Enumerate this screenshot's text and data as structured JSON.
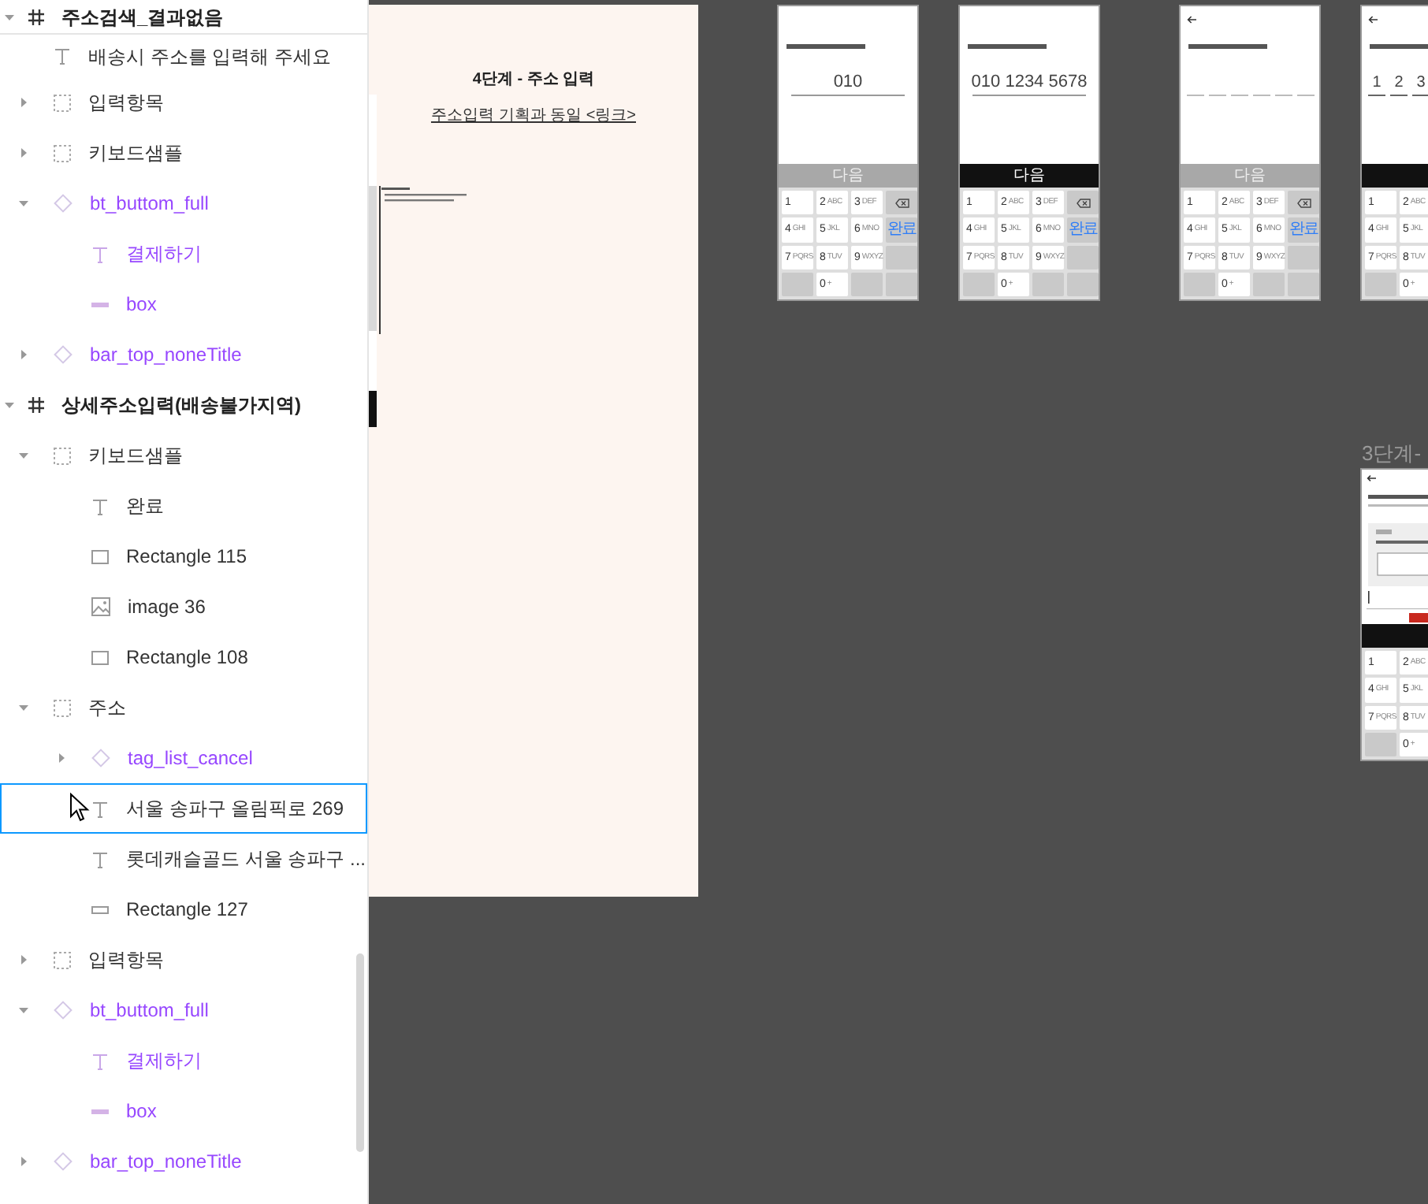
{
  "layers": [
    {
      "name": "주소검색_결과없음",
      "kind": "frame",
      "expanded": true,
      "selected": false,
      "children": [
        {
          "name": "배송시 주소를 입력해 주세요",
          "kind": "text",
          "selected": false
        },
        {
          "name": "입력항목",
          "kind": "group",
          "expanded": false,
          "selected": false
        },
        {
          "name": "키보드샘플",
          "kind": "group",
          "expanded": false,
          "selected": false
        },
        {
          "name": "bt_buttom_full",
          "kind": "component",
          "expanded": true,
          "selected": false,
          "children": [
            {
              "name": "결제하기",
              "kind": "text",
              "selected": false
            },
            {
              "name": "box",
              "kind": "line",
              "selected": false
            }
          ]
        },
        {
          "name": "bar_top_noneTitle",
          "kind": "component",
          "expanded": false,
          "selected": false
        }
      ]
    },
    {
      "name": "상세주소입력(배송불가지역)",
      "kind": "frame",
      "expanded": true,
      "selected": false,
      "children": [
        {
          "name": "키보드샘플",
          "kind": "group",
          "expanded": true,
          "selected": false,
          "children": [
            {
              "name": "완료",
              "kind": "text",
              "selected": false
            },
            {
              "name": "Rectangle 115",
              "kind": "rect",
              "selected": false
            },
            {
              "name": "image 36",
              "kind": "image",
              "selected": false
            },
            {
              "name": "Rectangle 108",
              "kind": "rect",
              "selected": false
            }
          ]
        },
        {
          "name": "주소",
          "kind": "group",
          "expanded": true,
          "selected": false,
          "children": [
            {
              "name": "tag_list_cancel",
              "kind": "component",
              "expanded": false,
              "selected": false
            },
            {
              "name": "서울 송파구 올림픽로 269",
              "kind": "text",
              "selected": true
            },
            {
              "name": "롯데캐슬골드 서울 송파구 ...",
              "kind": "text",
              "selected": false
            },
            {
              "name": "Rectangle 127",
              "kind": "flat_rect",
              "selected": false
            }
          ]
        },
        {
          "name": "입력항목",
          "kind": "group",
          "expanded": false,
          "selected": false
        },
        {
          "name": "bt_buttom_full",
          "kind": "component",
          "expanded": true,
          "selected": false,
          "children": [
            {
              "name": "결제하기",
              "kind": "text",
              "selected": false
            },
            {
              "name": "box",
              "kind": "line",
              "selected": false
            }
          ]
        },
        {
          "name": "bar_top_noneTitle",
          "kind": "component",
          "expanded": false,
          "selected": false
        }
      ]
    }
  ],
  "board": {
    "title": "4단계 - 주소 입력",
    "link": "주소입력 기획과 동일 <링크>"
  },
  "phones": [
    {
      "kind": "phone_number",
      "value": "010",
      "next_label": "다음",
      "next_enabled": false,
      "key_rows": [
        [
          {
            "kind": "digit",
            "label": "1"
          },
          {
            "kind": "digit",
            "label": "2",
            "sub": "ABC"
          },
          {
            "kind": "digit",
            "label": "3",
            "sub": "DEF"
          },
          {
            "kind": "delete"
          }
        ],
        [
          {
            "kind": "digit",
            "label": "4",
            "sub": "GHI"
          },
          {
            "kind": "digit",
            "label": "5",
            "sub": "JKL"
          },
          {
            "kind": "digit",
            "label": "6",
            "sub": "MNO"
          },
          {
            "kind": "done",
            "label": "완료"
          }
        ],
        [
          {
            "kind": "digit",
            "label": "7",
            "sub": "PQRS"
          },
          {
            "kind": "digit",
            "label": "8",
            "sub": "TUV"
          },
          {
            "kind": "digit",
            "label": "9",
            "sub": "WXYZ"
          },
          {
            "kind": "blank"
          }
        ],
        [
          {
            "kind": "blank"
          },
          {
            "kind": "digit",
            "label": "0",
            "sub": "+"
          },
          {
            "kind": "blank"
          },
          {
            "kind": "blank"
          }
        ]
      ]
    },
    {
      "kind": "phone_number",
      "value": "010 1234 5678",
      "next_label": "다음",
      "next_enabled": true,
      "key_rows": [
        [
          {
            "kind": "digit",
            "label": "1"
          },
          {
            "kind": "digit",
            "label": "2",
            "sub": "ABC"
          },
          {
            "kind": "digit",
            "label": "3",
            "sub": "DEF"
          },
          {
            "kind": "delete"
          }
        ],
        [
          {
            "kind": "digit",
            "label": "4",
            "sub": "GHI"
          },
          {
            "kind": "digit",
            "label": "5",
            "sub": "JKL"
          },
          {
            "kind": "digit",
            "label": "6",
            "sub": "MNO"
          },
          {
            "kind": "done",
            "label": "완료"
          }
        ],
        [
          {
            "kind": "digit",
            "label": "7",
            "sub": "PQRS"
          },
          {
            "kind": "digit",
            "label": "8",
            "sub": "TUV"
          },
          {
            "kind": "digit",
            "label": "9",
            "sub": "WXYZ"
          },
          {
            "kind": "blank"
          }
        ],
        [
          {
            "kind": "blank"
          },
          {
            "kind": "digit",
            "label": "0",
            "sub": "+"
          },
          {
            "kind": "blank"
          },
          {
            "kind": "blank"
          }
        ]
      ]
    },
    {
      "kind": "code",
      "cells": [
        {
          "filled": false
        },
        {
          "filled": false
        },
        {
          "filled": false
        },
        {
          "filled": false
        },
        {
          "filled": false
        },
        {
          "filled": false
        }
      ],
      "next_label": "다음",
      "next_enabled": false,
      "key_rows": [
        [
          {
            "kind": "digit",
            "label": "1"
          },
          {
            "kind": "digit",
            "label": "2",
            "sub": "ABC"
          },
          {
            "kind": "digit",
            "label": "3",
            "sub": "DEF"
          },
          {
            "kind": "delete"
          }
        ],
        [
          {
            "kind": "digit",
            "label": "4",
            "sub": "GHI"
          },
          {
            "kind": "digit",
            "label": "5",
            "sub": "JKL"
          },
          {
            "kind": "digit",
            "label": "6",
            "sub": "MNO"
          },
          {
            "kind": "done",
            "label": "완료"
          }
        ],
        [
          {
            "kind": "digit",
            "label": "7",
            "sub": "PQRS"
          },
          {
            "kind": "digit",
            "label": "8",
            "sub": "TUV"
          },
          {
            "kind": "digit",
            "label": "9",
            "sub": "WXYZ"
          },
          {
            "kind": "blank"
          }
        ],
        [
          {
            "kind": "blank"
          },
          {
            "kind": "digit",
            "label": "0",
            "sub": "+"
          },
          {
            "kind": "blank"
          },
          {
            "kind": "blank"
          }
        ]
      ]
    },
    {
      "kind": "code",
      "cells": [
        {
          "filled": true,
          "digit": "1"
        },
        {
          "filled": true,
          "digit": "2"
        },
        {
          "filled": true,
          "digit": "3"
        }
      ],
      "next_enabled": true,
      "key_rows": [
        [
          {
            "kind": "digit",
            "label": "1"
          },
          {
            "kind": "digit",
            "label": "2",
            "sub": "ABC"
          }
        ],
        [
          {
            "kind": "digit",
            "label": "4",
            "sub": "GHI"
          },
          {
            "kind": "digit",
            "label": "5",
            "sub": "JKL"
          }
        ],
        [
          {
            "kind": "digit",
            "label": "7",
            "sub": "PQRS"
          },
          {
            "kind": "digit",
            "label": "8",
            "sub": "TUV"
          }
        ],
        [
          {
            "kind": "blank"
          },
          {
            "kind": "digit",
            "label": "0",
            "sub": "+"
          }
        ]
      ]
    },
    {
      "kind": "address",
      "frame_label": "3단계-",
      "next_enabled": true,
      "key_rows": [
        [
          {
            "kind": "digit",
            "label": "1"
          },
          {
            "kind": "digit",
            "label": "2",
            "sub": "ABC"
          }
        ],
        [
          {
            "kind": "digit",
            "label": "4",
            "sub": "GHI"
          },
          {
            "kind": "digit",
            "label": "5",
            "sub": "JKL"
          }
        ],
        [
          {
            "kind": "digit",
            "label": "7",
            "sub": "PQRS"
          },
          {
            "kind": "digit",
            "label": "8",
            "sub": "TUV"
          }
        ],
        [
          {
            "kind": "blank"
          },
          {
            "kind": "digit",
            "label": "0",
            "sub": "+"
          }
        ]
      ]
    }
  ]
}
